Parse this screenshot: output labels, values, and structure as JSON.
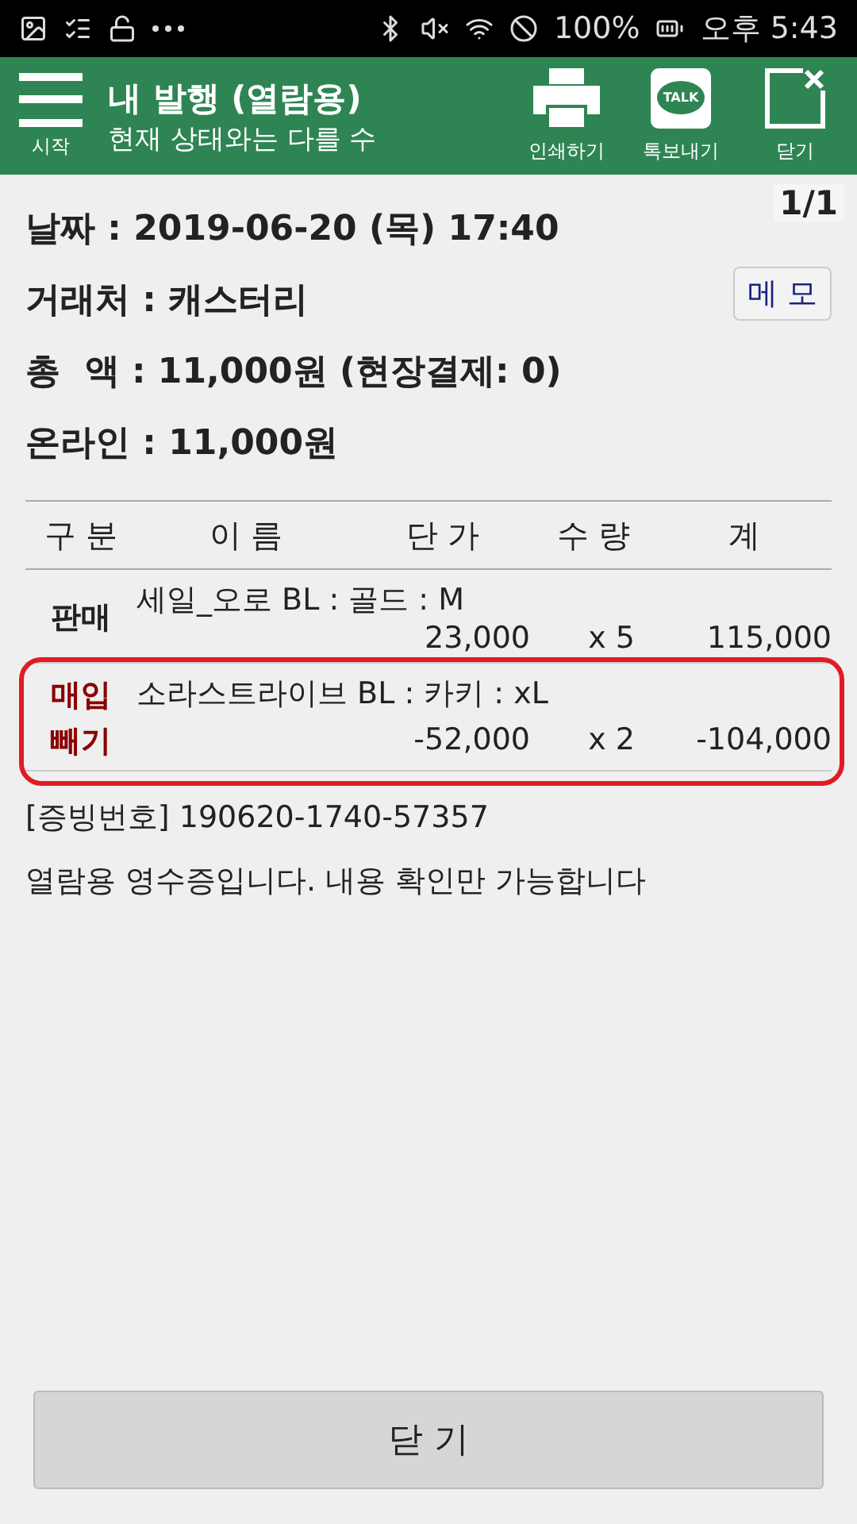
{
  "status_bar": {
    "battery": "100%",
    "time": "오후 5:43"
  },
  "header": {
    "menu_label": "시작",
    "title": "내 발행 (열람용)",
    "subtitle": "현재 상태와는 다를 수",
    "actions": [
      {
        "kind": "print",
        "label": "인쇄하기"
      },
      {
        "kind": "talk",
        "label": "톡보내기",
        "badge": "TALK"
      },
      {
        "kind": "close",
        "label": "닫기"
      }
    ]
  },
  "page_indicator": "1/1",
  "memo_button": "메 모",
  "info": [
    "날짜 : 2019-06-20 (목) 17:40",
    "거래처 : 캐스터리",
    "총  액 : 11,000원 (현장결제: 0)",
    "온라인 : 11,000원"
  ],
  "table": {
    "columns": [
      "구 분",
      "이 름",
      "단 가",
      "수 량",
      "계"
    ],
    "rows": [
      {
        "kind": "sale",
        "type": [
          "판매"
        ],
        "name": "세일_오로 BL : 골드 : M",
        "price": "23,000",
        "qty": "x 5",
        "total": "115,000",
        "highlighted": false
      },
      {
        "kind": "return",
        "type": [
          "매입",
          "빼기"
        ],
        "name": "소라스트라이브 BL : 카키 : xL",
        "price": "-52,000",
        "qty": "x 2",
        "total": "-104,000",
        "highlighted": true
      }
    ]
  },
  "receipt_number": "[증빙번호] 190620-1740-57357",
  "notice": "열람용 영수증입니다. 내용 확인만 가능합니다",
  "close_button": "닫 기"
}
